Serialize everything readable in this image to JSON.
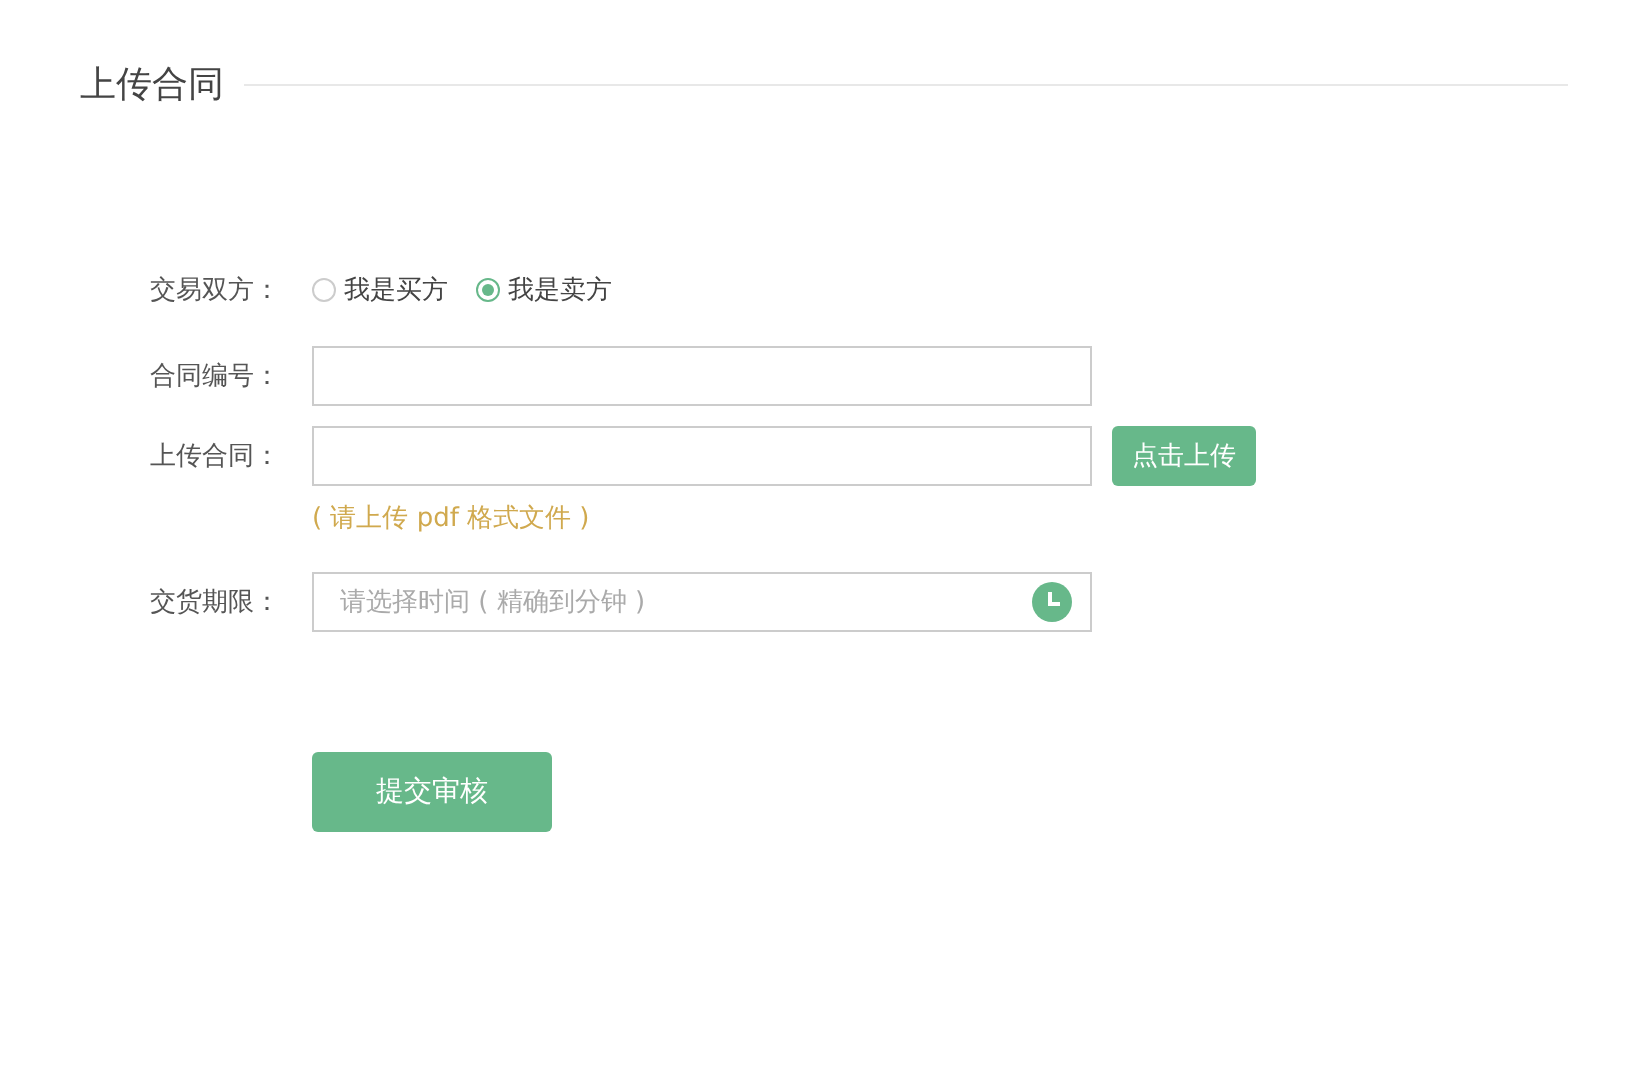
{
  "title": "上传合同",
  "parties": {
    "label": "交易双方：",
    "options": [
      {
        "label": "我是买方",
        "selected": false
      },
      {
        "label": "我是卖方",
        "selected": true
      }
    ]
  },
  "contract_number": {
    "label": "合同编号："
  },
  "upload": {
    "label": "上传合同：",
    "button": "点击上传",
    "hint": "( 请上传 pdf 格式文件 )"
  },
  "deadline": {
    "label": "交货期限：",
    "placeholder": "请选择时间 ( 精确到分钟 )"
  },
  "submit": "提交审核"
}
